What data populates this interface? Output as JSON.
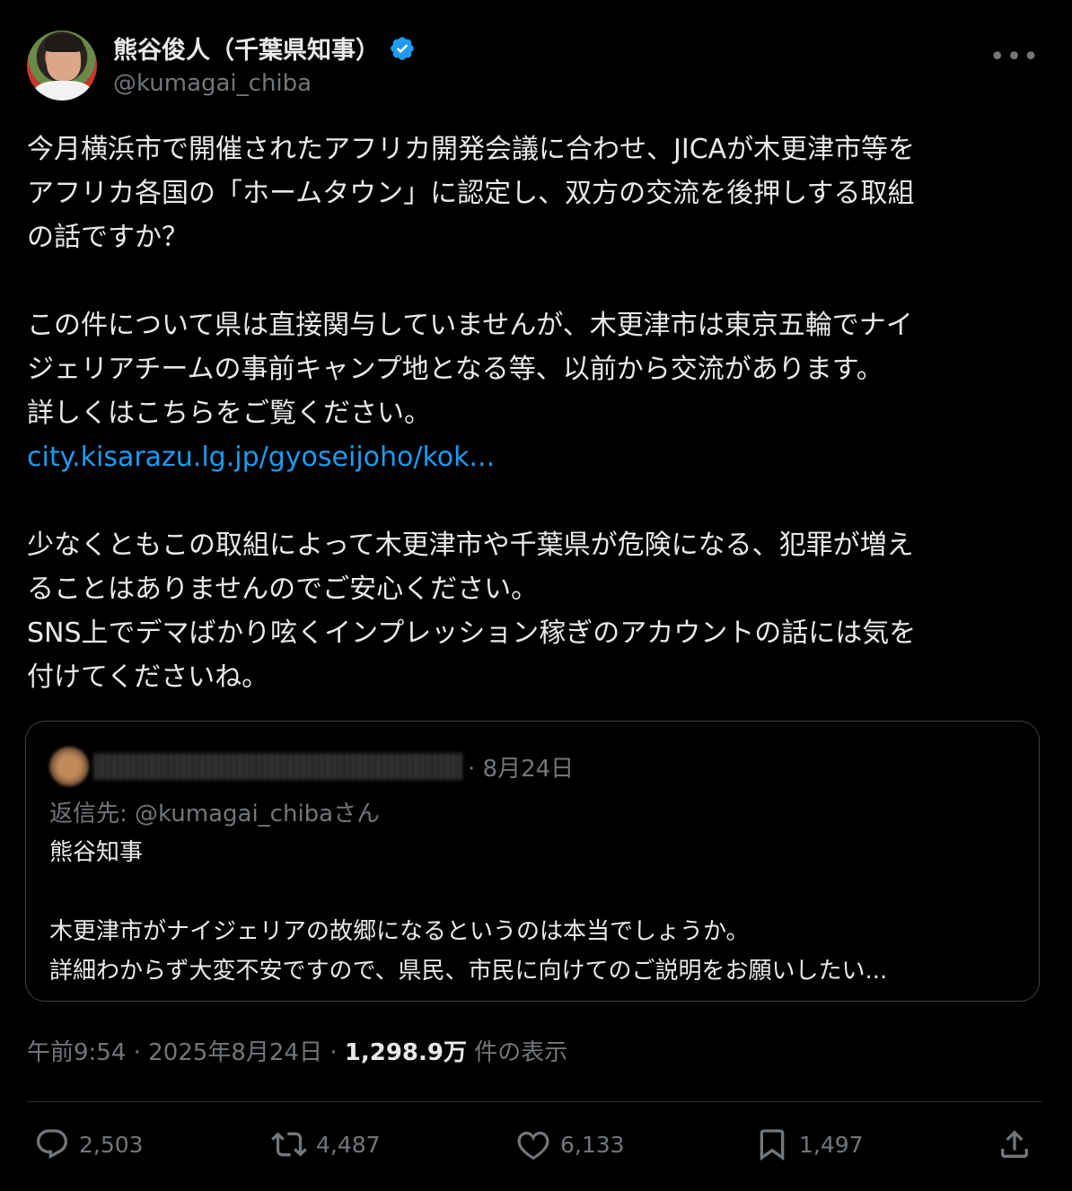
{
  "author": {
    "name": "熊谷俊人（千葉県知事）",
    "handle": "@kumagai_chiba"
  },
  "post": {
    "para1": [
      "今月横浜市で開催されたアフリカ開発会議に合わせ、JICAが木更津市等を",
      "アフリカ各国の「ホームタウン」に認定し、双方の交流を後押しする取組",
      "の話ですか？"
    ],
    "para2": [
      "この件について県は直接関与していませんが、木更津市は東京五輪でナイ",
      "ジェリアチームの事前キャンプ地となる等、以前から交流があります。",
      "詳しくはこちらをご覧ください。"
    ],
    "link": "city.kisarazu.lg.jp/gyoseijoho/kok...",
    "para3": [
      "少なくともこの取組によって木更津市や千葉県が危険になる、犯罪が増え",
      "ることはありませんのでご安心ください。",
      "SNS上でデマばかり呟くインプレッション稼ぎのアカウントの話には気を",
      "付けてくださいね。"
    ]
  },
  "quote": {
    "date": "· 8月24日",
    "reply_to": "返信先: @kumagai_chibaさん",
    "line1": "熊谷知事",
    "line2": "木更津市がナイジェリアの故郷になるというのは本当でしょうか。",
    "line3": "詳細わからず大変不安ですので、県民、市民に向けてのご説明をお願いしたい..."
  },
  "meta": {
    "time": "午前9:54 · 2025年8月24日 · ",
    "views": "1,298.9万",
    "views_label": " 件の表示"
  },
  "actions": {
    "replies": "2,503",
    "reposts": "4,487",
    "likes": "6,133",
    "bookmarks": "1,497"
  },
  "colors": {
    "background": "#000000",
    "text": "#e7e9ea",
    "muted": "#71767b",
    "link": "#1d9bf0",
    "verified": "#1d9bf0"
  },
  "icons": [
    "verified-badge-icon",
    "more-icon",
    "reply-icon",
    "repost-icon",
    "like-icon",
    "bookmark-icon",
    "share-icon"
  ]
}
